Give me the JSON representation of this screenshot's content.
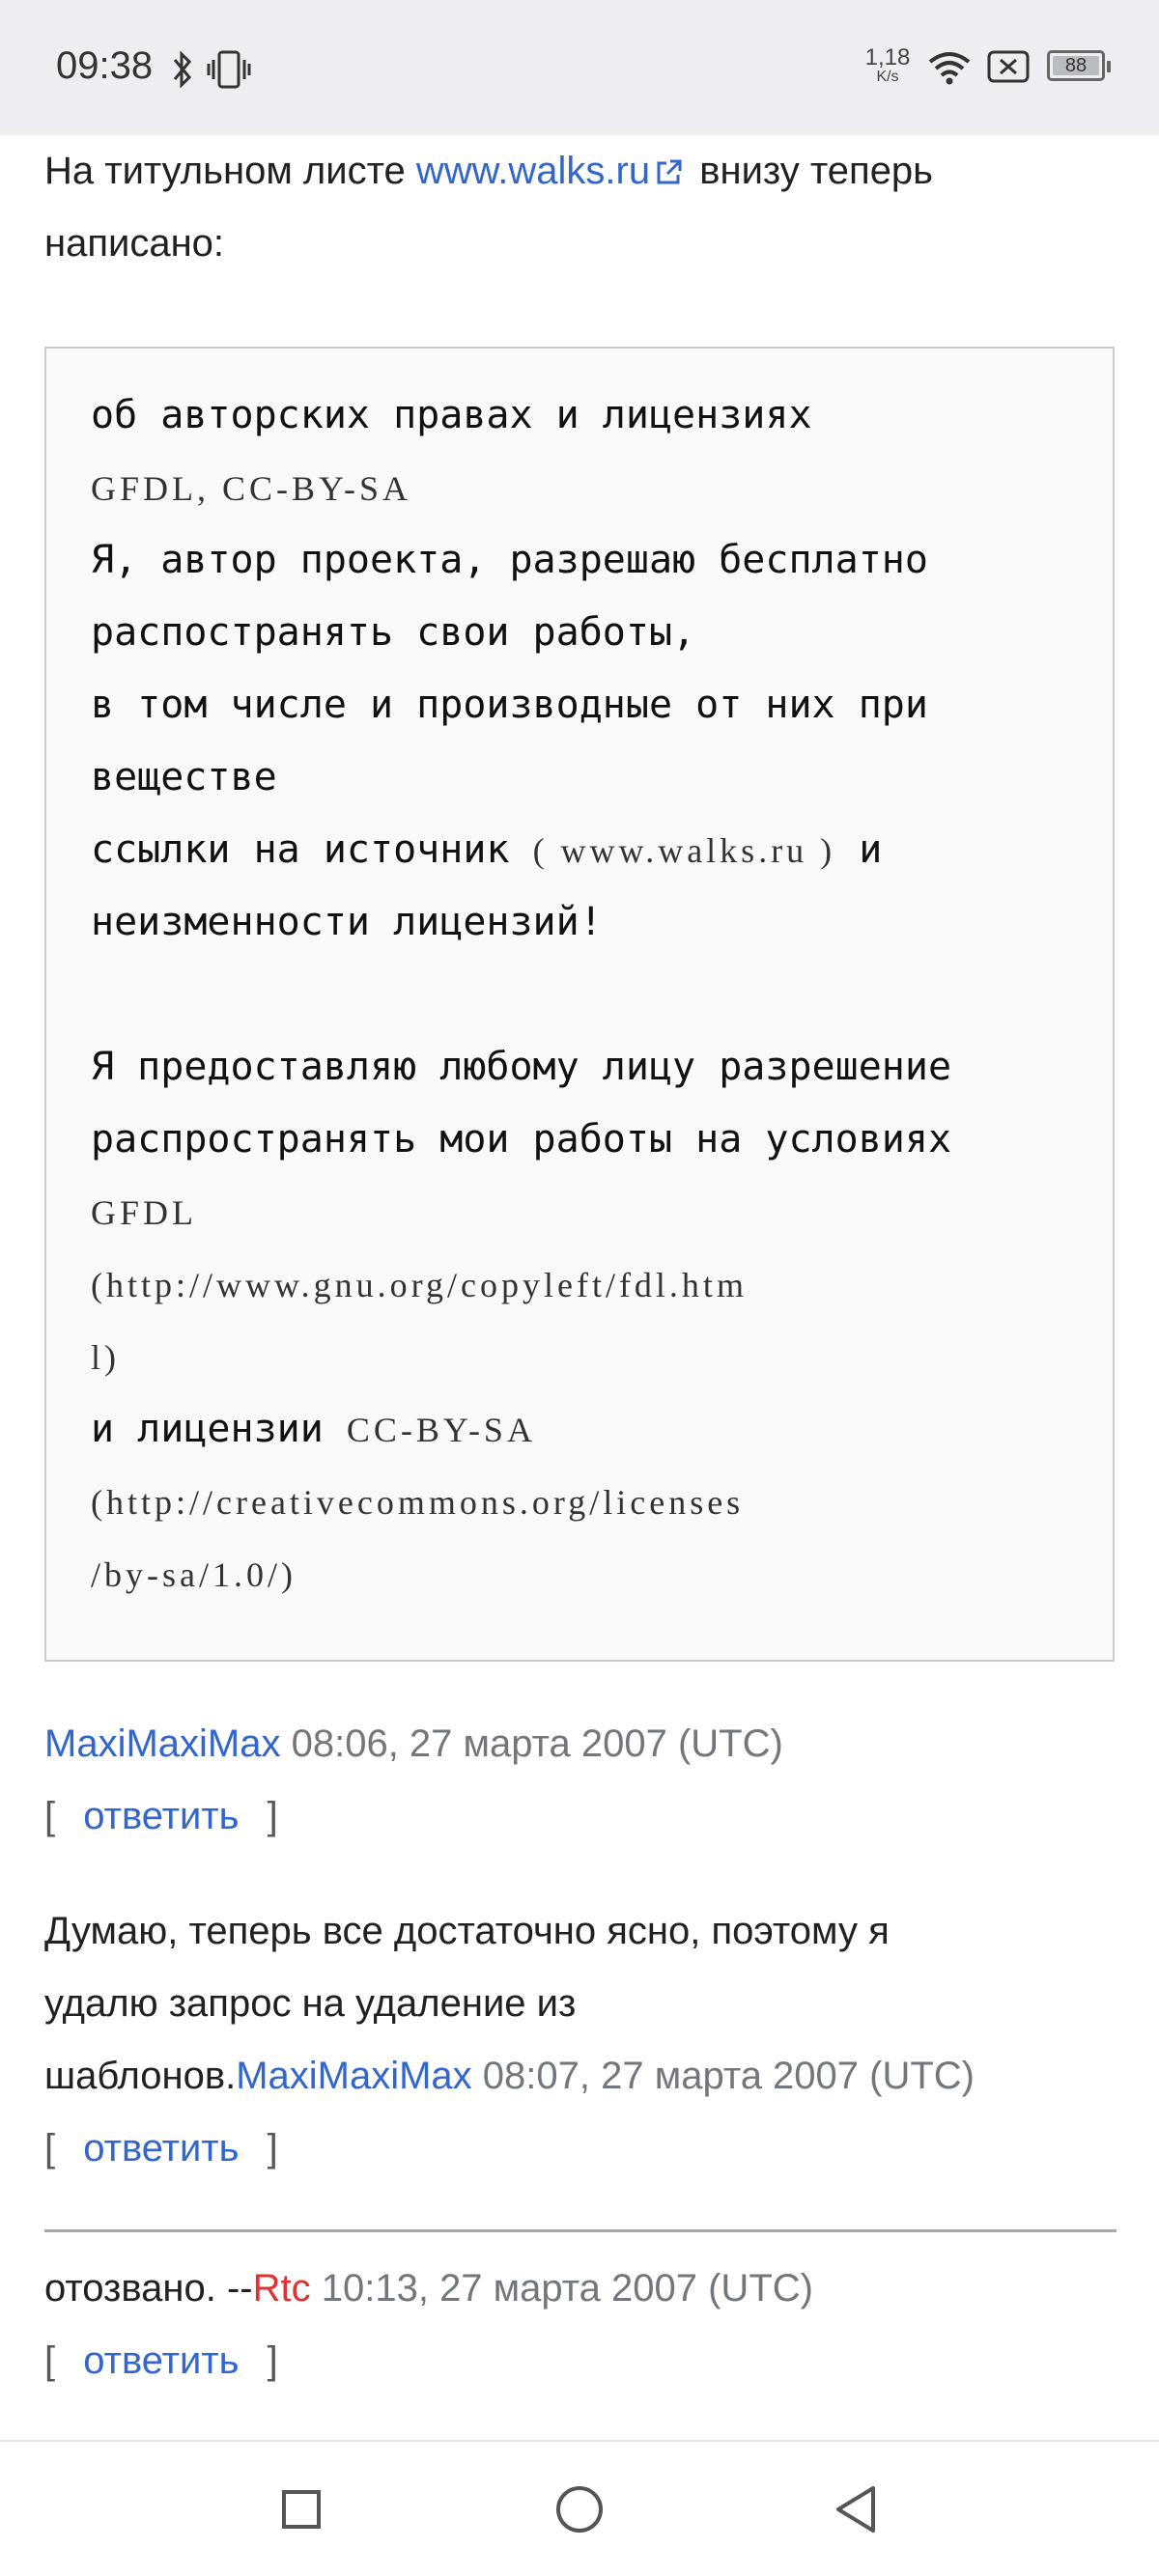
{
  "status_bar": {
    "time": "09:38",
    "net_speed_value": "1,18",
    "net_speed_unit": "K/s",
    "battery_level": "88",
    "icons": [
      "bluetooth-icon",
      "vibrate-icon",
      "wifi-icon",
      "sim-off-icon",
      "battery-icon"
    ]
  },
  "intro": {
    "text_before": "На титульном листе ",
    "link": "www.walks.ru",
    "text_after": " внизу теперь",
    "line2": "написано:"
  },
  "codebox": {
    "lines": [
      [
        {
          "t": "об авторских правах и лицензиях"
        }
      ],
      [
        {
          "t": "GFDL, CC-BY-SA",
          "latin": true
        }
      ],
      [
        {
          "t": "Я, автор проекта, разрешаю бесплатно"
        }
      ],
      [
        {
          "t": "распостранять свои работы,"
        }
      ],
      [
        {
          "t": "в том числе и производные от них при"
        }
      ],
      [
        {
          "t": "веществе"
        }
      ],
      [
        {
          "t": "ссылки на источник "
        },
        {
          "t": "( www.walks.ru )",
          "latin": true
        },
        {
          "t": " и"
        }
      ],
      [
        {
          "t": "неизменности лицензий!"
        }
      ],
      [
        {
          "t": ""
        }
      ],
      [
        {
          "t": "Я предоставляю любому лицу разрешение"
        }
      ],
      [
        {
          "t": "распространять мои работы на условиях"
        }
      ],
      [
        {
          "t": "GFDL",
          "latin": true
        }
      ],
      [
        {
          "t": "(http://www.gnu.org/copyleft/fdl.htm",
          "latin": true
        }
      ],
      [
        {
          "t": "l)",
          "latin": true
        }
      ],
      [
        {
          "t": "и лицензии "
        },
        {
          "t": "CC-BY-SA",
          "latin": true
        }
      ],
      [
        {
          "t": "(http://creativecommons.org/licenses",
          "latin": true
        }
      ],
      [
        {
          "t": "/by-sa/1.0/)",
          "latin": true
        }
      ]
    ]
  },
  "comments": [
    {
      "author": "MaxiMaxiMax",
      "timestamp": " 08:06, 27 марта 2007 (UTC)",
      "reply_label": "ответить"
    },
    {
      "text_line1": "Думаю, теперь все достаточно ясно, поэтому я",
      "text_line2": "удалю запрос на удаление из",
      "text_line3": "шаблонов.",
      "author": "MaxiMaxiMax",
      "timestamp": " 08:07, 27 марта 2007 (UTC)",
      "reply_label": "ответить"
    },
    {
      "text": "отозвано. --",
      "author": "Rtc",
      "timestamp": " 10:13, 27 марта 2007 (UTC)",
      "reply_label": "ответить"
    }
  ],
  "bracket_open": "[",
  "bracket_close": "]",
  "colors": {
    "link": "#3366cc",
    "redlink": "#d33333",
    "timestamp": "#72777d"
  },
  "nav_bar": {
    "buttons": [
      "recent-apps-icon",
      "home-icon",
      "back-icon"
    ]
  }
}
